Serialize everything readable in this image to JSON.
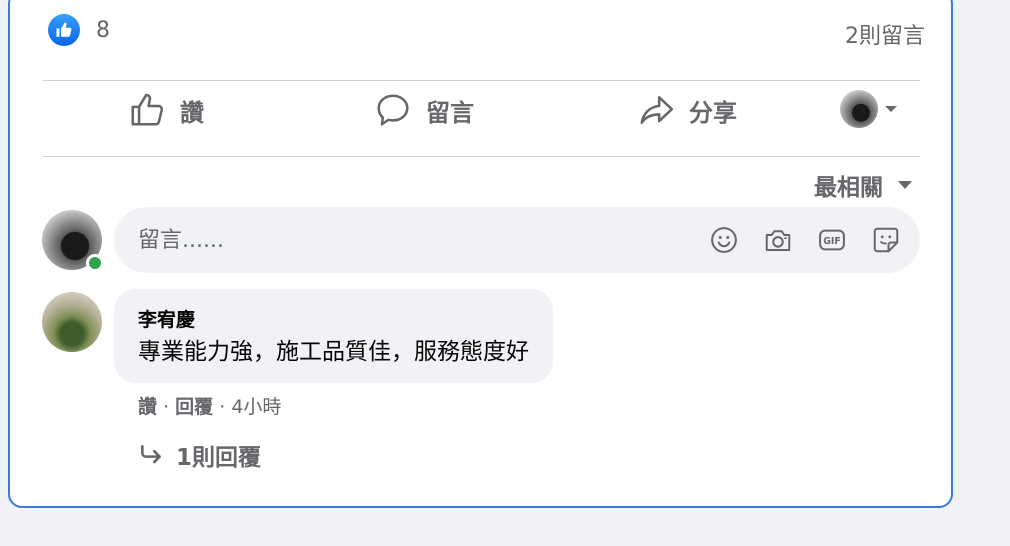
{
  "post": {
    "reaction_count": "8",
    "comment_count": "2則留言"
  },
  "actions": {
    "like_label": "讚",
    "comment_label": "留言",
    "share_label": "分享"
  },
  "comments": {
    "sort_label": "最相關",
    "composer_placeholder": "留言......",
    "items": [
      {
        "author": "李宥慶",
        "text": "專業能力強，施工品質佳，服務態度好",
        "like_label": "讚",
        "reply_label": "回覆",
        "time": "4小時",
        "replies_label": "1則回覆"
      }
    ]
  },
  "icons": {
    "like_badge": "like-icon",
    "composer": [
      "smiley-icon",
      "camera-icon",
      "gif-icon",
      "sticker-icon"
    ]
  },
  "colors": {
    "accent": "#1877f2",
    "card_border": "#3a7bd5",
    "online": "#31a24c",
    "muted_text": "#65676b"
  }
}
